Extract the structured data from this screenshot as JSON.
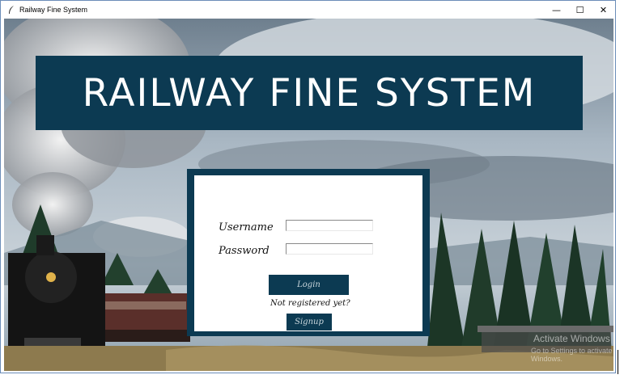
{
  "window": {
    "title": "Railway Fine System",
    "minimize_symbol": "—",
    "maximize_symbol": "☐",
    "close_symbol": "✕",
    "icon": "feather-icon"
  },
  "banner": {
    "title": "RAILWAY FINE SYSTEM"
  },
  "login": {
    "username_label": "Username",
    "password_label": "Password",
    "username_value": "",
    "password_value": "",
    "login_button": "Login",
    "not_registered_text": "Not registered yet?",
    "signup_button": "Signup"
  },
  "watermark": {
    "line1": "Activate Windows",
    "line2": "Go to Settings to activate Windows."
  },
  "colors": {
    "panel": "#0c3a52",
    "sky": "#8fa6b8",
    "smoke": "#d8dadc",
    "trees": "#1f3b2a"
  }
}
